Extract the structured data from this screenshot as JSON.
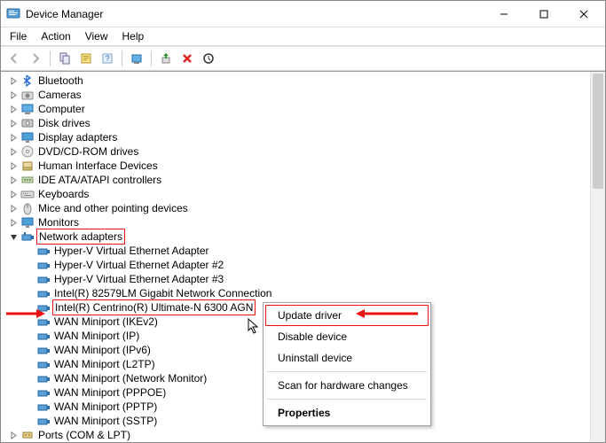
{
  "window": {
    "title": "Device Manager"
  },
  "menubar": [
    "File",
    "Action",
    "View",
    "Help"
  ],
  "tree": {
    "bluetooth": "Bluetooth",
    "cameras": "Cameras",
    "computer": "Computer",
    "disk": "Disk drives",
    "display": "Display adapters",
    "dvd": "DVD/CD-ROM drives",
    "hid": "Human Interface Devices",
    "ide": "IDE ATA/ATAPI controllers",
    "keyboards": "Keyboards",
    "mice": "Mice and other pointing devices",
    "monitors": "Monitors",
    "netadapters": "Network adapters",
    "adapters": [
      "Hyper-V Virtual Ethernet Adapter",
      "Hyper-V Virtual Ethernet Adapter #2",
      "Hyper-V Virtual Ethernet Adapter #3",
      "Intel(R) 82579LM Gigabit Network Connection",
      "Intel(R) Centrino(R) Ultimate-N 6300 AGN",
      "WAN Miniport (IKEv2)",
      "WAN Miniport (IP)",
      "WAN Miniport (IPv6)",
      "WAN Miniport (L2TP)",
      "WAN Miniport (Network Monitor)",
      "WAN Miniport (PPPOE)",
      "WAN Miniport (PPTP)",
      "WAN Miniport (SSTP)"
    ],
    "ports": "Ports (COM & LPT)"
  },
  "contextmenu": {
    "update": "Update driver",
    "disable": "Disable device",
    "uninstall": "Uninstall device",
    "scan": "Scan for hardware changes",
    "properties": "Properties"
  }
}
